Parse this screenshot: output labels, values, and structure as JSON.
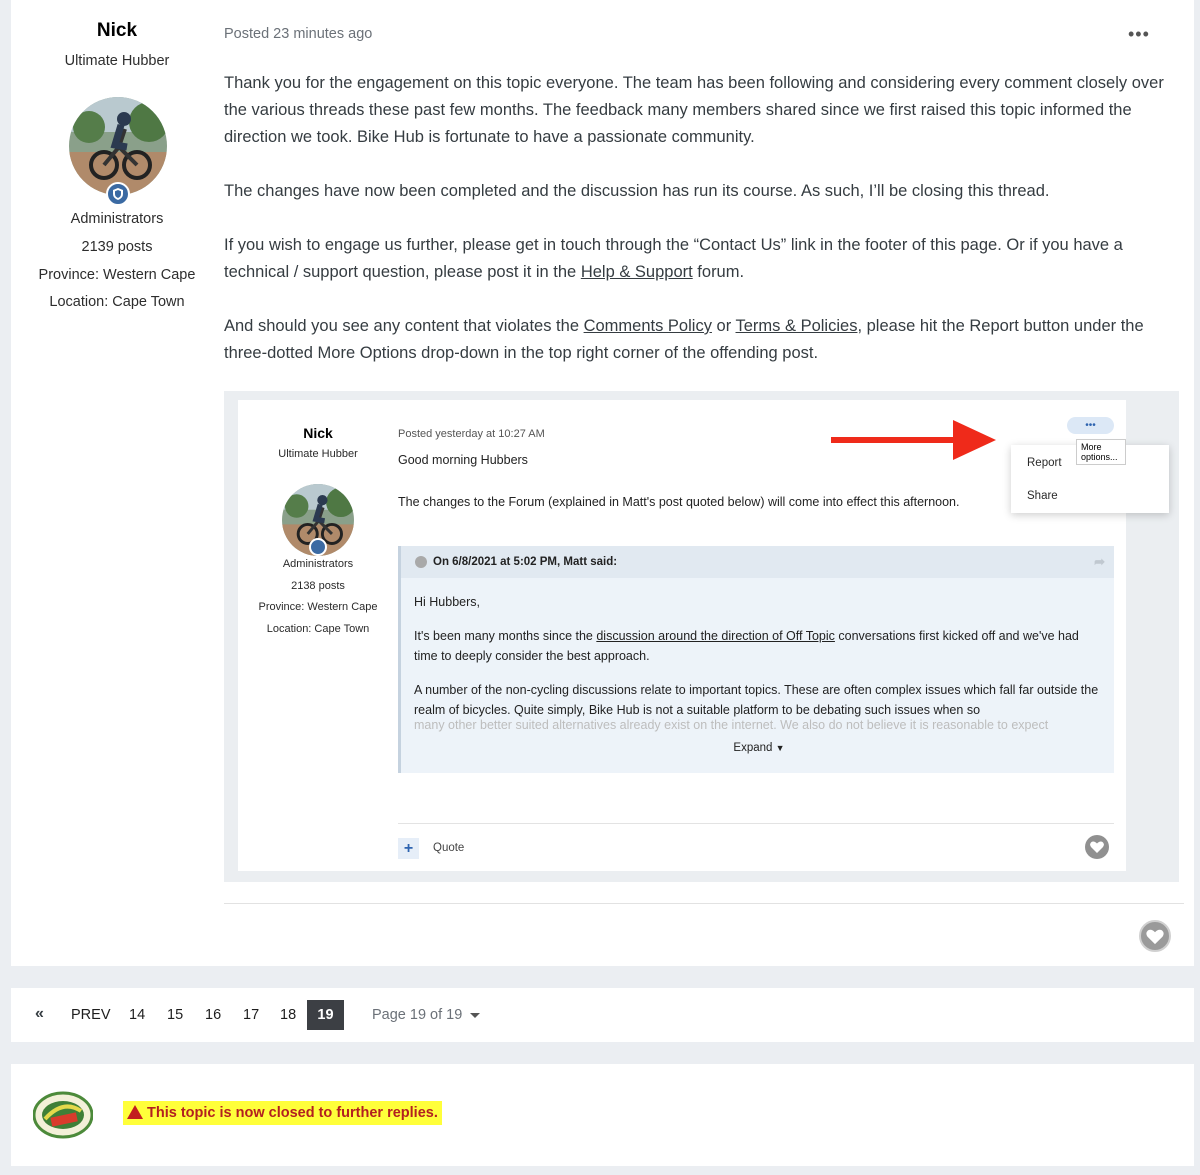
{
  "post": {
    "author": {
      "name": "Nick",
      "title": "Ultimate Hubber",
      "group": "Administrators",
      "posts": "2139 posts",
      "province": "Province: Western Cape",
      "location": "Location: Cape Town"
    },
    "meta": "Posted 23 minutes ago",
    "more_icon": "•••",
    "p1": "Thank you for the engagement on this topic everyone. The team has been following and considering every comment closely over the various threads these past few months. The feedback many members shared since we first raised this topic informed the direction we took. Bike Hub is fortunate to have a passionate community.",
    "p2": "The changes have now been completed and the discussion has run its course. As such, I’ll be closing this thread.",
    "p3_a": "If you wish to engage us further, please get in touch through the “Contact Us” link in the footer of this page. Or if you have a technical / support question, please post it in the ",
    "p3_link": "Help & Support",
    "p3_b": " forum.",
    "p4_a": "And should you see any content that violates the ",
    "p4_link1": "Comments Policy",
    "p4_mid": " or ",
    "p4_link2": "Terms & Policies",
    "p4_b": ", please hit the Report button under the three-dotted More Options drop-down in the top right corner of the offending post."
  },
  "embed": {
    "name": "Nick",
    "title": "Ultimate Hubber",
    "group": "Administrators",
    "posts": "2138 posts",
    "province": "Province: Western Cape",
    "location": "Location: Cape Town",
    "meta": "Posted yesterday at 10:27 AM",
    "line1": "Good morning Hubbers",
    "line2": "The changes to the Forum (explained in Matt's post quoted below) will come into effect this afternoon.",
    "dots": "•••",
    "tooltip": "More options...",
    "menu": [
      "Report",
      "Share"
    ],
    "quote_head": "On 6/8/2021 at 5:02 PM, Matt said:",
    "quote_greeting": "Hi Hubbers,",
    "quote_p1_a": "It's been many months since the ",
    "quote_p1_link": "discussion around the direction of Off Topic",
    "quote_p1_b": " conversations first kicked off and we've had time to deeply consider the best approach.",
    "quote_p2": "A number of the non-cycling discussions relate to important topics. These are often complex issues which fall far outside the realm of bicycles. Quite simply, Bike Hub is not a suitable platform to be debating such issues when so",
    "quote_fade": "many other better suited alternatives already exist on the internet. We also do not believe it is reasonable to expect",
    "expand": "Expand",
    "plus": "+",
    "quote_btn": "Quote"
  },
  "pagination": {
    "first": "«",
    "prev": "PREV",
    "pages": [
      "14",
      "15",
      "16",
      "17",
      "18"
    ],
    "current": "19",
    "jump": "Page 19 of 19"
  },
  "closed": {
    "notice": "This topic is now closed to further replies."
  },
  "colors": {
    "page_bg": "#ebeef2",
    "badge": "#3b6aa3",
    "arrow": "#ef2a1a",
    "highlight": "#ffff3a",
    "notice_text": "#b22020"
  }
}
